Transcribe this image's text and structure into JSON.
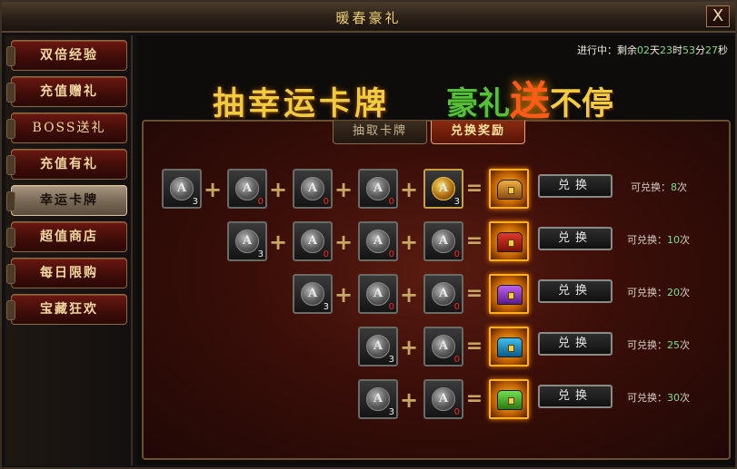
{
  "window": {
    "title": "暖春豪礼",
    "close_label": "X"
  },
  "sidebar": {
    "items": [
      {
        "label": "双倍经验"
      },
      {
        "label": "充值赠礼"
      },
      {
        "label": "BOSS送礼"
      },
      {
        "label": "充值有礼"
      },
      {
        "label": "幸运卡牌",
        "active": true
      },
      {
        "label": "超值商店"
      },
      {
        "label": "每日限购"
      },
      {
        "label": "宝藏狂欢"
      }
    ]
  },
  "timer": {
    "prefix": "进行中：剩余",
    "days": "02",
    "days_unit": "天",
    "hours": "23",
    "hours_unit": "时",
    "minutes": "53",
    "minutes_unit": "分",
    "seconds": "27",
    "seconds_unit": "秒"
  },
  "banner": {
    "left": "抽幸运卡牌",
    "right_a": "豪礼",
    "right_b": "送",
    "right_c": "不停"
  },
  "tabs": [
    {
      "label": "抽取卡牌"
    },
    {
      "label": "兑换奖励",
      "active": true
    }
  ],
  "rows": [
    {
      "cards": [
        "3",
        "0",
        "0",
        "0",
        "3"
      ],
      "button": "兑换",
      "note_label": "可兑换：",
      "note_count": "8",
      "note_unit": "次"
    },
    {
      "cards": [
        "3",
        "0",
        "0",
        "0"
      ],
      "button": "兑换",
      "note_label": "可兑换：",
      "note_count": "10",
      "note_unit": "次"
    },
    {
      "cards": [
        "3",
        "0",
        "0"
      ],
      "button": "兑换",
      "note_label": "可兑换：",
      "note_count": "20",
      "note_unit": "次"
    },
    {
      "cards": [
        "3",
        "0"
      ],
      "button": "兑换",
      "note_label": "可兑换：",
      "note_count": "25",
      "note_unit": "次"
    },
    {
      "cards": [
        "3",
        "0"
      ],
      "button": "兑换",
      "note_label": "可兑换：",
      "note_count": "30",
      "note_unit": "次"
    }
  ],
  "colors": {
    "accent_gold": "#f2cc40",
    "count_green": "#7de07d",
    "count_red": "#ff2020"
  }
}
